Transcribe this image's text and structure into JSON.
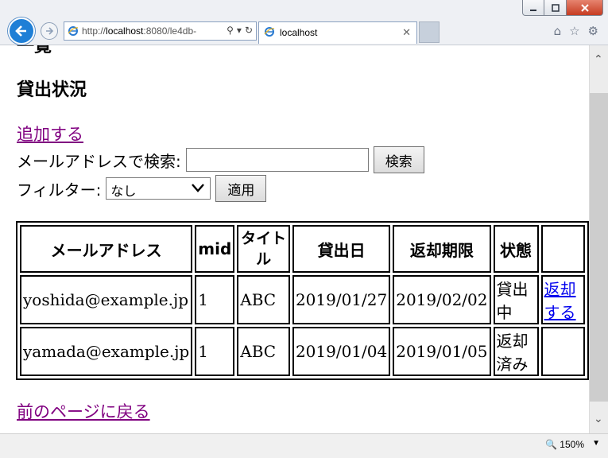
{
  "browser": {
    "url_prefix": "http://",
    "url_host": "localhost",
    "url_rest": ":8080/le4db-",
    "tab_title": "localhost",
    "zoom": "150%"
  },
  "page": {
    "cut_heading": "一覧",
    "heading": "貸出状況",
    "add_link": "追加する",
    "search_label": "メールアドレスで検索:",
    "search_value": "",
    "search_button": "検索",
    "filter_label": "フィルター:",
    "filter_selected": "なし",
    "apply_button": "適用",
    "back_link": "前のページに戻る"
  },
  "table": {
    "headers": [
      "メールアドレス",
      "mid",
      "タイトル",
      "貸出日",
      "返却期限",
      "状態"
    ],
    "rows": [
      {
        "email": "yoshida@example.jp",
        "mid": "1",
        "title": "ABC",
        "loan_date": "2019/01/27",
        "due_date": "2019/02/02",
        "status": "貸出中",
        "action": "返却する"
      },
      {
        "email": "yamada@example.jp",
        "mid": "1",
        "title": "ABC",
        "loan_date": "2019/01/04",
        "due_date": "2019/01/05",
        "status": "返却済み",
        "action": ""
      }
    ]
  }
}
